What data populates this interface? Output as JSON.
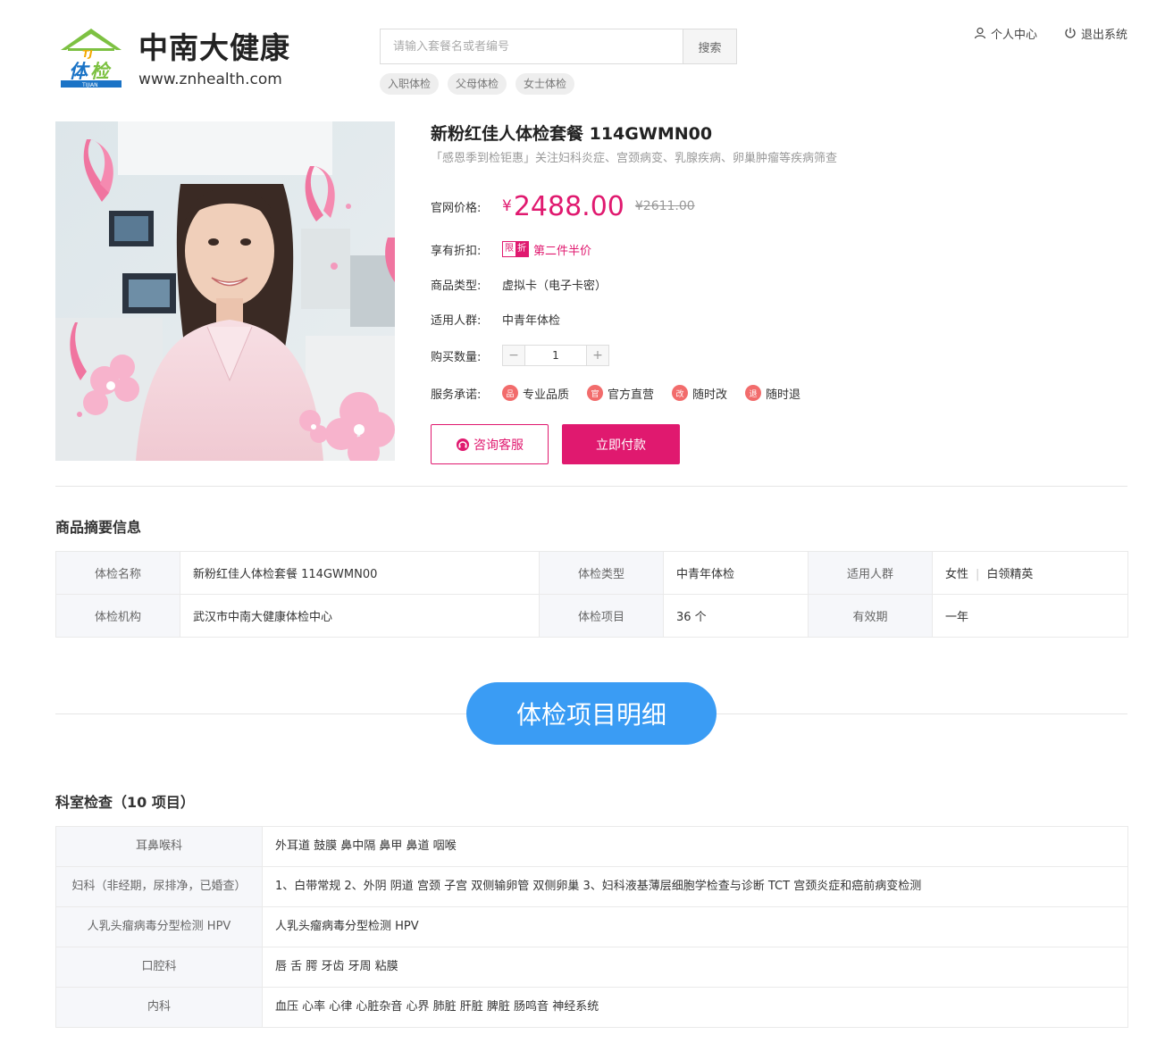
{
  "brand": {
    "logo_text": "体检",
    "logo_sub": "TIJIAN",
    "logo_mark": "TJ",
    "name": "中南大健康",
    "url": "www.znhealth.com"
  },
  "search": {
    "placeholder": "请输入套餐名或者编号",
    "button": "搜索",
    "tags": [
      "入职体检",
      "父母体检",
      "女士体检"
    ]
  },
  "top_links": {
    "profile": "个人中心",
    "logout": "退出系统"
  },
  "product": {
    "title": "新粉红佳人体检套餐 114GWMN00",
    "subtitle": "「感恩季到检钜惠」关注妇科炎症、宫颈病变、乳腺疾病、卵巢肿瘤等疾病筛查",
    "price_label": "官网价格:",
    "currency": "¥",
    "price": "2488.00",
    "old_price": "¥2611.00",
    "discount_label": "享有折扣:",
    "discount_badge_1": "限",
    "discount_badge_2": "折",
    "discount_text": "第二件半价",
    "type_label": "商品类型:",
    "type_value": "虚拟卡（电子卡密）",
    "crowd_label": "适用人群:",
    "crowd_value": "中青年体检",
    "qty_label": "购买数量:",
    "qty_value": "1",
    "qty_minus": "−",
    "qty_plus": "+",
    "promise_label": "服务承诺:",
    "promises": [
      "专业品质",
      "官方直营",
      "随时改",
      "随时退"
    ],
    "promise_icons": [
      "品",
      "官",
      "改",
      "退"
    ],
    "consult_button": "咨询客服",
    "pay_button": "立即付款"
  },
  "summary": {
    "title": "商品摘要信息",
    "name_label": "体检名称",
    "name_value": "新粉红佳人体检套餐 114GWMN00",
    "type_label": "体检类型",
    "type_value": "中青年体检",
    "crowd_label": "适用人群",
    "crowd_values": [
      "女性",
      "白领精英"
    ],
    "org_label": "体检机构",
    "org_value": "武汉市中南大健康体检中心",
    "items_label": "体检项目",
    "items_value": "36 个",
    "valid_label": "有效期",
    "valid_value": "一年"
  },
  "detail": {
    "banner": "体检项目明细",
    "section_title": "科室检查（10 项目）",
    "rows": [
      {
        "dept": "耳鼻喉科",
        "content": "外耳道 鼓膜 鼻中隔 鼻甲 鼻道 咽喉"
      },
      {
        "dept": "妇科（非经期，尿排净，已婚查）",
        "content": "1、白带常规 2、外阴 阴道 宫颈 子宫 双侧输卵管 双侧卵巢 3、妇科液基薄层细胞学检查与诊断 TCT 宫颈炎症和癌前病变检测"
      },
      {
        "dept": "人乳头瘤病毒分型检测 HPV",
        "content": "人乳头瘤病毒分型检测 HPV"
      },
      {
        "dept": "口腔科",
        "content": "唇 舌 腭 牙齿 牙周 粘膜"
      },
      {
        "dept": "内科",
        "content": "血压 心率 心律 心脏杂音 心界 肺脏 肝脏 脾脏 肠鸣音 神经系统"
      }
    ]
  },
  "colors": {
    "accent": "#e0196f",
    "banner": "#3a9cf4",
    "logo_green": "#7dc142",
    "logo_blue": "#1a73c6"
  }
}
